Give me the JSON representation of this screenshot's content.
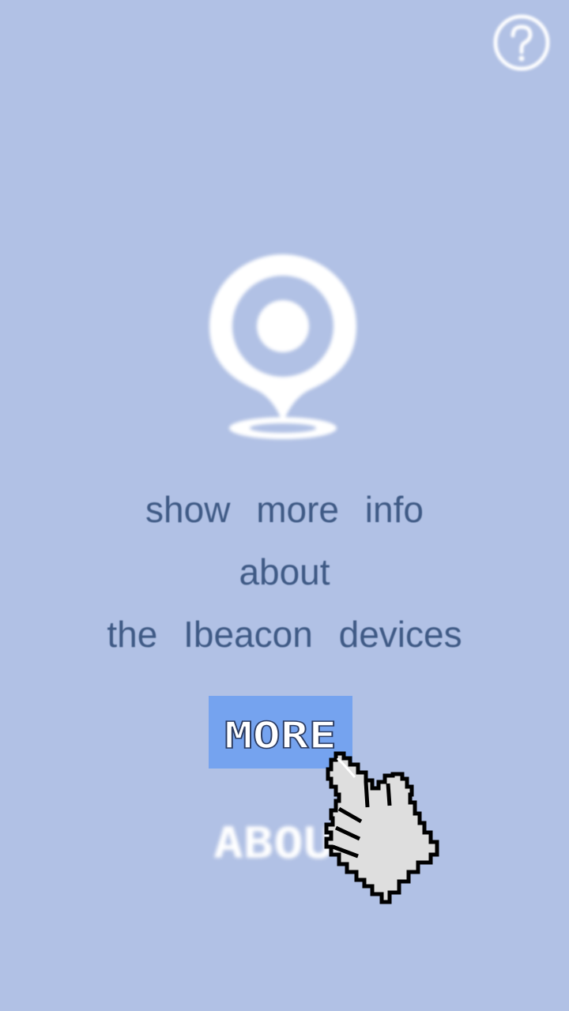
{
  "help": {
    "icon": "question-circle-icon",
    "color": "#ffffff"
  },
  "beacon": {
    "icon": "location-pin-icon",
    "color": "#ffffff"
  },
  "message": {
    "line1": "show more info",
    "line2": "about",
    "line3": "the Ibeacon devices"
  },
  "buttons": {
    "more_label": "MORE",
    "more_color": "#75a3ef",
    "about_label": "ABOUT"
  },
  "cursor": {
    "icon": "hand-pointer-icon"
  },
  "colors": {
    "background": "#b1c1e5",
    "text": "#3f5a85"
  }
}
